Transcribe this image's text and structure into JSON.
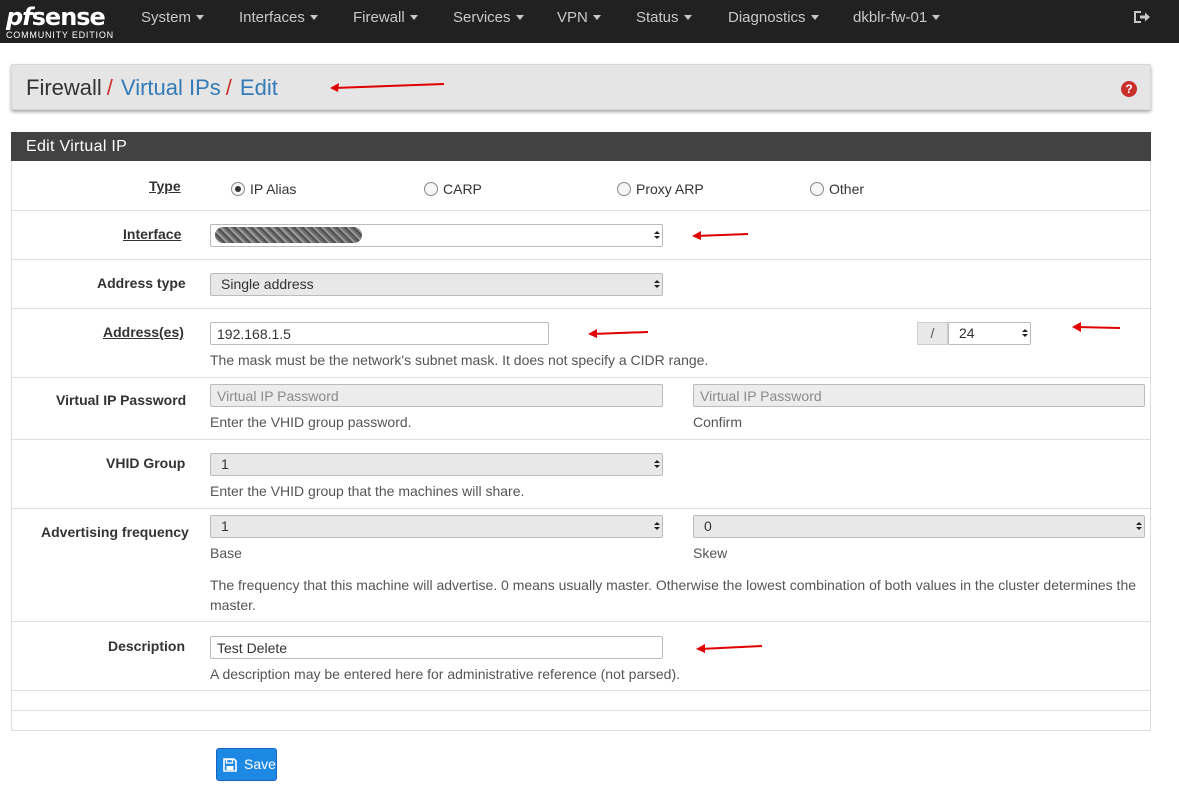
{
  "navbar": {
    "logo_main_pf": "pf",
    "logo_main_rest": "sense",
    "logo_sub": "COMMUNITY EDITION",
    "items": [
      {
        "label": "System"
      },
      {
        "label": "Interfaces"
      },
      {
        "label": "Firewall"
      },
      {
        "label": "Services"
      },
      {
        "label": "VPN"
      },
      {
        "label": "Status"
      },
      {
        "label": "Diagnostics"
      },
      {
        "label": "dkblr-fw-01"
      }
    ],
    "logout_icon": "sign-out-icon"
  },
  "breadcrumb": {
    "first": "Firewall",
    "sep": "/",
    "second": "Virtual IPs",
    "third": "Edit",
    "help_glyph": "?"
  },
  "panel": {
    "title": "Edit Virtual IP"
  },
  "form": {
    "type": {
      "label": "Type",
      "options": [
        "IP Alias",
        "CARP",
        "Proxy ARP",
        "Other"
      ],
      "selected": "IP Alias"
    },
    "interface": {
      "label": "Interface",
      "value": ""
    },
    "address_type": {
      "label": "Address type",
      "value": "Single address"
    },
    "address": {
      "label": "Address(es)",
      "value": "192.168.1.5",
      "slash": "/",
      "mask": "24",
      "help": "The mask must be the network's subnet mask. It does not specify a CIDR range."
    },
    "vip_password": {
      "label": "Virtual IP Password",
      "placeholder": "Virtual IP Password",
      "confirm_placeholder": "Virtual IP Password",
      "help": "Enter the VHID group password.",
      "confirm_help": "Confirm"
    },
    "vhid_group": {
      "label": "VHID Group",
      "value": "1",
      "help": "Enter the VHID group that the machines will share."
    },
    "adv_freq": {
      "label": "Advertising frequency",
      "base_value": "1",
      "skew_value": "0",
      "base_help": "Base",
      "skew_help": "Skew",
      "help": "The frequency that this machine will advertise. 0 means usually master. Otherwise the lowest combination of both values in the cluster determines the master."
    },
    "description": {
      "label": "Description",
      "value": "Test Delete",
      "help": "A description may be entered here for administrative reference (not parsed)."
    }
  },
  "save_button": {
    "label": "Save",
    "icon": "save-icon"
  },
  "colors": {
    "navbar_bg": "#212121",
    "panel_heading_bg": "#424242",
    "link_blue": "#337ab7",
    "breadcrumb_sep_red": "#c9302c",
    "primary_button": "#1e88e5",
    "annotation_arrow": "#e00000"
  }
}
